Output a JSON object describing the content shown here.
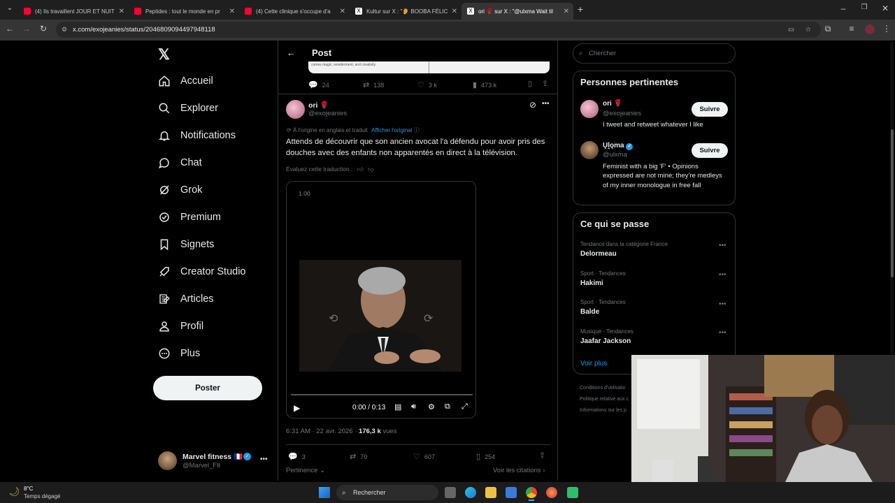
{
  "browser": {
    "tabs": [
      {
        "label": "(4) Ils travaillent JOUR ET NUIT"
      },
      {
        "label": "Peptides : tout le monde en pr"
      },
      {
        "label": "(4) Cette clinique s'occupe d'a"
      },
      {
        "label": "Kultur sur X : \"👂 BOOBA FÉLIC"
      },
      {
        "label": "ori 🌹 sur X : \"@ulxma Wait til"
      }
    ],
    "url": "x.com/exojeanies/status/2046809094497948118"
  },
  "nav": {
    "items": [
      "Accueil",
      "Explorer",
      "Notifications",
      "Chat",
      "Grok",
      "Premium",
      "Signets",
      "Creator Studio",
      "Articles",
      "Profil",
      "Plus"
    ],
    "post_button": "Poster",
    "account_name": "Marvel fitness 🇫🇷",
    "account_handle": "@Marvel_Flt"
  },
  "header": {
    "title": "Post"
  },
  "quoted_stats": {
    "replies": "24",
    "reposts": "138",
    "likes": "3 k",
    "views": "473 k"
  },
  "quoted_text": "comes magic, wonderment, and creativity.",
  "tweet": {
    "author": "ori 🌹",
    "handle": "@exojeanies",
    "translation_note": "À l'origine en anglais et traduit",
    "show_original": "Afficher l'original",
    "text": "Attends de découvrir que son ancien avocat l'a défendu pour avoir pris des douches avec des enfants non apparentés en direct à la télévision.",
    "rate_translation": "Évaluez cette traduction :",
    "video_speed": "1.00",
    "video_time": "0:00 / 0:13",
    "timestamp": "6:31 AM · 22 avr. 2026 · ",
    "views": "176,3 k",
    "views_label": "vues",
    "replies": "3",
    "reposts": "70",
    "likes": "607",
    "bookmarks": "254",
    "sort_label": "Pertinence",
    "quotes_link": "Voir les citations"
  },
  "sidebar": {
    "search_placeholder": "Chercher",
    "relevant_title": "Personnes pertinentes",
    "people": [
      {
        "name": "ori 🌹",
        "handle": "@exojeanies",
        "bio": "I tweet and retweet whatever I like",
        "follow": "Suivre"
      },
      {
        "name": "Ųḻǫma",
        "handle": "@ulxma",
        "bio": "Feminist with a big 'F' • Opinions expressed are not mine; they're medleys of my inner monologue in free fall",
        "follow": "Suivre"
      }
    ],
    "trends_title": "Ce qui se passe",
    "trends": [
      {
        "category": "Tendance dans la catégorie France",
        "name": "Delormeau"
      },
      {
        "category": "Sport · Tendances",
        "name": "Hakimi"
      },
      {
        "category": "Sport · Tendances",
        "name": "Balde"
      },
      {
        "category": "Musique · Tendances",
        "name": "Jaafar Jackson"
      }
    ],
    "show_more": "Voir plus",
    "footer": [
      "Conditions d'utilisatio",
      "Politique relative aux c",
      "Informations sur les p"
    ]
  },
  "taskbar": {
    "temp": "8°C",
    "weather": "Temps dégagé",
    "search": "Rechercher"
  },
  "colors": {
    "accent": "#1d9bf0",
    "bg": "#000000",
    "border": "#2f3336",
    "muted": "#71767b"
  }
}
